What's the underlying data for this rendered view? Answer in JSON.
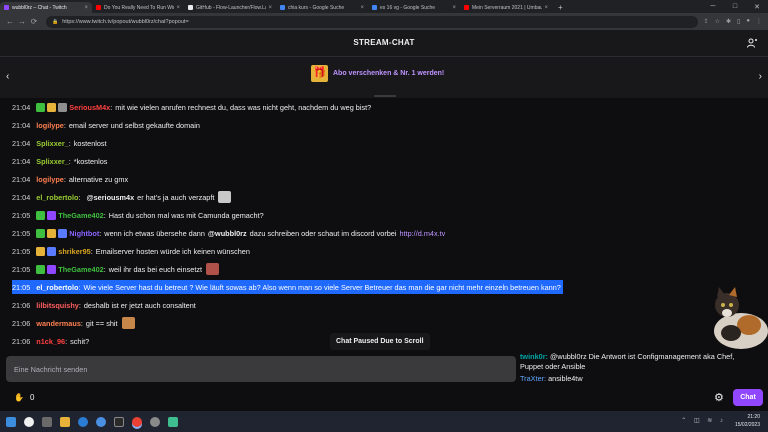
{
  "browser": {
    "tabs": [
      {
        "title": "wubbl0rz – Chat - Twitch",
        "color": "#9147ff",
        "active": true
      },
      {
        "title": "Do You Really Need To Run Win...",
        "color": "#ff0000",
        "active": false
      },
      {
        "title": "GitHub - Flow-Launcher/Flow.La...",
        "color": "#e8eaed",
        "active": false
      },
      {
        "title": "chia kurs - Google Suche",
        "color": "#4285f4",
        "active": false
      },
      {
        "title": "es 16 vg - Google Suche",
        "color": "#4285f4",
        "active": false
      },
      {
        "title": "Mein Serverraum 2021 | Umbau...",
        "color": "#ff0000",
        "active": false
      }
    ],
    "new_tab": "+",
    "url": "https://www.twitch.tv/popout/wubbl0rz/chat?popout=",
    "window_controls": {
      "minimize": "─",
      "maximize": "□",
      "close": "✕"
    },
    "nav": {
      "back": "←",
      "forward": "→",
      "reload": "⟳"
    }
  },
  "header": {
    "title": "STREAM-CHAT",
    "users_icon": "users-icon"
  },
  "banner": {
    "text": "Abo verschenken & Nr. 1 werden!",
    "prev": "‹",
    "next": "›",
    "gift_icon": "🎁"
  },
  "messages": [
    {
      "time": "21:04",
      "user": "SeriousM4x",
      "color": "#ff4040",
      "badges": [
        "#3fbf3f",
        "#e6b33a",
        "#8f8f8f"
      ],
      "text": "mit wie vielen anrufen rechnest du, dass was nicht geht, nachdem du weg bist?"
    },
    {
      "time": "21:04",
      "user": "logilype",
      "color": "#ff7f50",
      "badges": [],
      "text": "email server und selbst gekaufte domain"
    },
    {
      "time": "21:04",
      "user": "Splixxer_",
      "color": "#9acd32",
      "badges": [],
      "text": "kostenlost"
    },
    {
      "time": "21:04",
      "user": "Splixxer_",
      "color": "#9acd32",
      "badges": [],
      "text": "*kostenlos"
    },
    {
      "time": "21:04",
      "user": "logilype",
      "color": "#ff7f50",
      "badges": [],
      "text": "alternative zu gmx"
    },
    {
      "time": "21:04",
      "user": "el_robertolo",
      "color": "#9acd32",
      "badges": [],
      "mention": "@seriousm4x",
      "text": "er hat's ja auch verzapft",
      "emote": "#c8c8c8"
    },
    {
      "time": "21:05",
      "user": "TheGame402",
      "color": "#3fbf3f",
      "badges": [
        "#3fbf3f",
        "#9147ff"
      ],
      "text": "Hast du schon mal was mit Camunda gemacht?"
    },
    {
      "time": "21:05",
      "user": "Nightbot",
      "color": "#8a63ff",
      "badges": [
        "#3fbf3f",
        "#e6b33a",
        "#5a7bff"
      ],
      "text": "wenn ich etwas übersehe dann",
      "mention": "@wubbl0rz",
      "text2": "dazu schreiben oder schaut im discord vorbei",
      "link": "http://d.m4x.tv"
    },
    {
      "time": "21:05",
      "user": "shriker95",
      "color": "#daa520",
      "badges": [
        "#e6b33a",
        "#5a7bff"
      ],
      "text": "Emailserver hosten würde ich keinen wünschen"
    },
    {
      "time": "21:05",
      "user": "TheGame402",
      "color": "#3fbf3f",
      "badges": [
        "#3fbf3f",
        "#9147ff"
      ],
      "text": "weil ihr das bei euch einsetzt",
      "emote": "#b0524a"
    },
    {
      "time": "21:05",
      "user": "el_robertolo",
      "color": "#ffffff",
      "badges": [],
      "text": "Wie viele Server hast du betreut ? Wie läuft sowas ab? Also wenn man so viele Server Betreuer das man die gar nicht mehr einzeln betreuen kann?",
      "highlight": true
    },
    {
      "time": "21:06",
      "user": "lilbitsquishy",
      "color": "#ff5e5e",
      "badges": [],
      "text": "deshalb ist er jetzt auch consaltent"
    },
    {
      "time": "21:06",
      "user": "wandermaus",
      "color": "#ff7f50",
      "badges": [],
      "text": "git == shit",
      "emote": "#c8874a"
    },
    {
      "time": "21:06",
      "user": "n1ck_96",
      "color": "#ff4040",
      "badges": [],
      "text": "schit?"
    }
  ],
  "paused_label": "Chat Paused Due to Scroll",
  "composer": {
    "placeholder": "Eine Nachricht senden"
  },
  "overlay": {
    "line1_user": "twink0r:",
    "line1_text": "@wubbl0rz Die Antwort ist Configmanagement aka Chef,",
    "line2_text": "Puppet oder Ansible",
    "line3_user": "TraXter:",
    "line3_text": "ansible4tw"
  },
  "bottom": {
    "points": "0",
    "points_icon": "channel-points-icon",
    "chat_button": "Chat",
    "gear_icon": "gear-icon"
  },
  "taskbar": {
    "time": "21:20",
    "date": "15/02/2023"
  }
}
